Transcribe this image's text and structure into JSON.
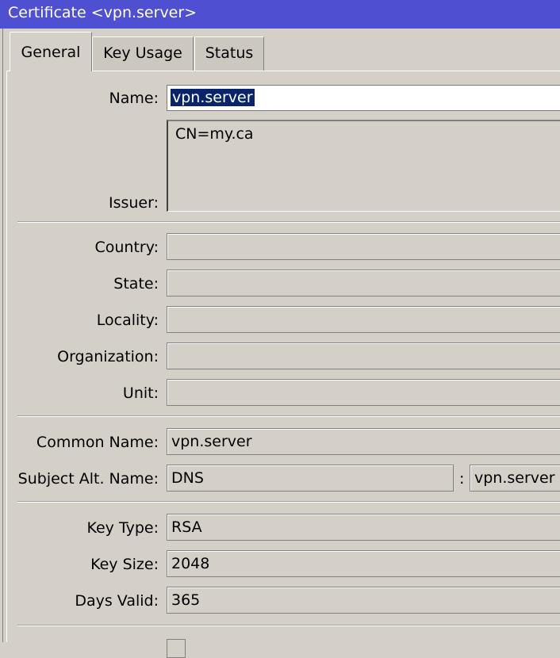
{
  "window": {
    "title": "Certificate <vpn.server>"
  },
  "tabs": [
    {
      "label": "General",
      "active": true
    },
    {
      "label": "Key Usage",
      "active": false
    },
    {
      "label": "Status",
      "active": false
    }
  ],
  "general": {
    "name": {
      "label": "Name:",
      "value": "vpn.server"
    },
    "issuer": {
      "label": "Issuer:",
      "value": "CN=my.ca"
    },
    "country": {
      "label": "Country:",
      "value": ""
    },
    "state": {
      "label": "State:",
      "value": ""
    },
    "locality": {
      "label": "Locality:",
      "value": ""
    },
    "organization": {
      "label": "Organization:",
      "value": ""
    },
    "unit": {
      "label": "Unit:",
      "value": ""
    },
    "common_name": {
      "label": "Common Name:",
      "value": "vpn.server"
    },
    "subject_alt_name": {
      "label": "Subject Alt. Name:",
      "type": "DNS",
      "separator": ":",
      "value": "vpn.server"
    },
    "key_type": {
      "label": "Key Type:",
      "value": "RSA"
    },
    "key_size": {
      "label": "Key Size:",
      "value": "2048"
    },
    "days_valid": {
      "label": "Days Valid:",
      "value": "365"
    }
  }
}
